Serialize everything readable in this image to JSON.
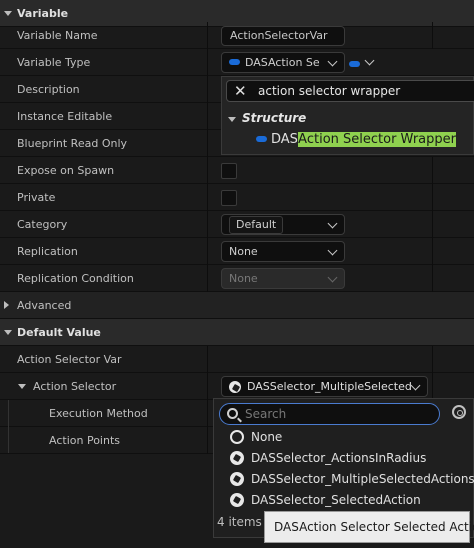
{
  "variable_section": {
    "title": "Variable",
    "rows": {
      "name": {
        "label": "Variable Name",
        "value": "ActionSelectorVar"
      },
      "type": {
        "label": "Variable Type",
        "value": "DASAction Se"
      },
      "description": {
        "label": "Description"
      },
      "instance_editable": {
        "label": "Instance Editable"
      },
      "blueprint_read_only": {
        "label": "Blueprint Read Only"
      },
      "expose_on_spawn": {
        "label": "Expose on Spawn"
      },
      "private": {
        "label": "Private"
      },
      "category": {
        "label": "Category",
        "value": "Default"
      },
      "replication": {
        "label": "Replication",
        "value": "None"
      },
      "replication_condition": {
        "label": "Replication Condition",
        "value": "None"
      }
    },
    "advanced": "Advanced"
  },
  "type_picker": {
    "search_text": "action selector wrapper",
    "category": "Structure",
    "result_prefix": "DAS",
    "result_match": "Action Selector Wrapper",
    "close_icon": "close-icon",
    "accent_color": "#8fd14f",
    "pin_color": "#1a6bd8"
  },
  "default_section": {
    "title": "Default Value",
    "var_label": "Action Selector Var",
    "selector_label": "Action Selector",
    "selector_value": "DASSelector_MultipleSelected",
    "execution_method": "Execution Method",
    "action_points": "Action Points"
  },
  "selector_picker": {
    "placeholder": "Search",
    "options": [
      "None",
      "DASSelector_ActionsInRadius",
      "DASSelector_MultipleSelectedActions",
      "DASSelector_SelectedAction"
    ],
    "count": "4 items",
    "tooltip": "DASAction Selector Selected Action",
    "focus_color": "#4a7bd0"
  }
}
